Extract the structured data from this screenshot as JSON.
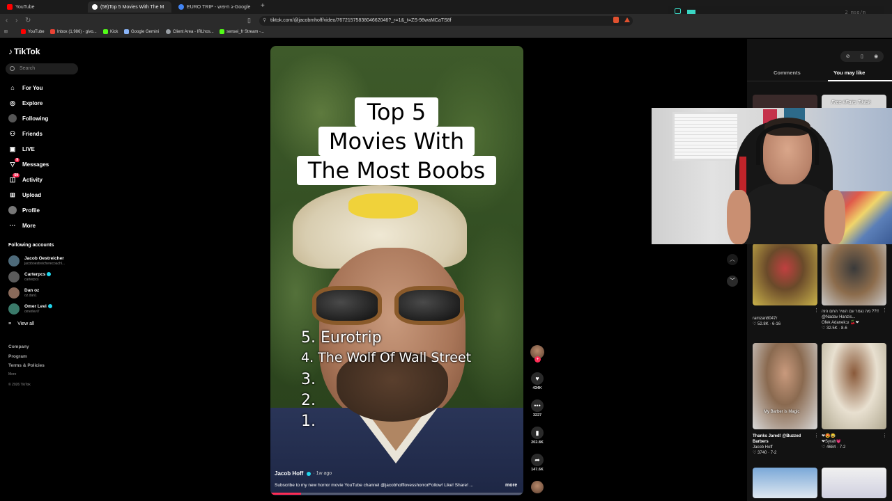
{
  "browser": {
    "tabs": [
      {
        "label": "YouTube",
        "color": "#ff0000"
      },
      {
        "label": "(58)Top 5 Movies With The M",
        "color": "#ffffff"
      },
      {
        "label": "EURO TRIP - ג חיפוש-Google",
        "color": "#4285f4"
      }
    ],
    "url": "tiktok.com/@jacobmhoff/video/7672157583804662046?_r=1&_t=ZS-98waMCaTS8f",
    "bookmarks": [
      {
        "label": "YouTube",
        "color": "#ff0000"
      },
      {
        "label": "Inbox (1,986) - givo...",
        "color": "#ea4335"
      },
      {
        "label": "Kick",
        "color": "#53fc18"
      },
      {
        "label": "Google Gemini",
        "color": "#8ab4f8"
      },
      {
        "label": "Client Area - IRLhos...",
        "color": "#9aa0a6"
      },
      {
        "label": "sensei_fr Stream -...",
        "color": "#53fc18"
      }
    ],
    "overlay_text": "2 msg/m"
  },
  "sidebar": {
    "logo": "TikTok",
    "search_placeholder": "Search",
    "nav": [
      {
        "label": "For You",
        "icon": "home-icon"
      },
      {
        "label": "Explore",
        "icon": "compass-icon"
      },
      {
        "label": "Following",
        "icon": "following-icon"
      },
      {
        "label": "Friends",
        "icon": "friends-icon"
      },
      {
        "label": "LIVE",
        "icon": "live-icon"
      },
      {
        "label": "Messages",
        "icon": "messages-icon",
        "badge": "9"
      },
      {
        "label": "Activity",
        "icon": "activity-icon",
        "badge": "59"
      },
      {
        "label": "Upload",
        "icon": "upload-icon"
      },
      {
        "label": "Profile",
        "icon": "profile-icon"
      },
      {
        "label": "More",
        "icon": "more-icon"
      }
    ],
    "following_title": "Following accounts",
    "accounts": [
      {
        "name": "Jacob Oestreicher",
        "handle": "jacoboestreicherecoachl...",
        "verified": false
      },
      {
        "name": "Carterpcs",
        "handle": "carterpcs",
        "verified": true
      },
      {
        "name": "Dan oz",
        "handle": "oz.dan1",
        "verified": false
      },
      {
        "name": "Omer Levi",
        "handle": "omerlevi7",
        "verified": true
      }
    ],
    "view_all": "View all",
    "footer": [
      "Company",
      "Program",
      "Terms & Policies"
    ],
    "footer_more": "More",
    "copyright": "© 2026 TikTok"
  },
  "video": {
    "title_lines": [
      "Top 5",
      "Movies With",
      "The Most Boobs"
    ],
    "list": [
      "5. Eurotrip",
      "4. The Wolf Of Wall Street",
      "3.",
      "2.",
      "1."
    ],
    "author": "Jacob Hoff",
    "time": "· 1w ago",
    "caption": "Subscribe to my new horror movie YouTube channel @jacobhofflovesshorrorFollow! Like! Share! ...",
    "more": "more",
    "progress": 0.12
  },
  "actions": {
    "likes": "434K",
    "comments": "3227",
    "saves": "202.8K",
    "shares": "147.6K"
  },
  "right_panel": {
    "tabs": [
      "Comments",
      "You may like"
    ],
    "items": [
      {
        "title": "",
        "author": "ramzan8047r",
        "stats": "♡ 52.8K · 6-16",
        "thumb_text": ""
      },
      {
        "title": "מה נגמר עם השיר החם הזה ??!! @Nadav Hanzis...",
        "author": "Ofek Adanekוב 🍒❤",
        "stats": "♡ 32.5K · 8-6",
        "thumb_text": ""
      },
      {
        "title": "Thanks Jared! @Buzzed Barbers",
        "author": "Jacob Hoff",
        "stats": "♡ 3740 · 7-2",
        "thumb_text": "My Barber is Magic"
      },
      {
        "title": "❤😍😂",
        "author": "❤Syrah💗",
        "stats": "♡ 4684 · 7-2",
        "thumb_text": ""
      }
    ],
    "top_thumb_text": "Free #Fairs Tiktok"
  }
}
